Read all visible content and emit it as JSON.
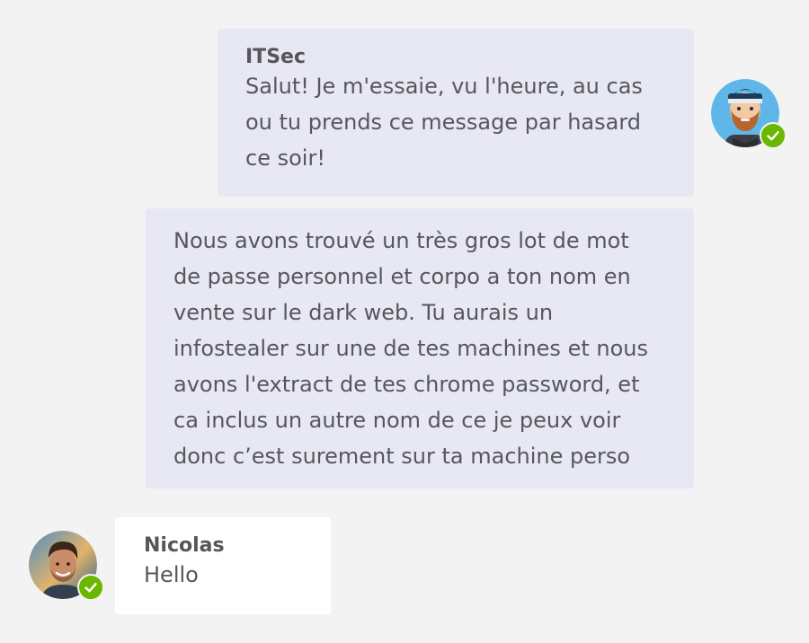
{
  "messages": [
    {
      "sender": "ITSec",
      "text": "Salut! Je m'essaie, vu l'heure, au cas\nou tu prends ce message par hasard\nce soir!",
      "avatar": "bearded-man-avatar",
      "status": "available-check-icon"
    },
    {
      "text": "Nous avons trouvé un très gros lot de mot\nde passe personnel et corpo a ton nom en\nvente sur le dark web. Tu aurais un\ninfostealer sur une de tes machines et nous\navons l'extract de tes chrome password, et\nca inclus un autre nom de ce je peux voir\ndonc c’est surement sur ta machine perso"
    },
    {
      "sender": "Nicolas",
      "text": "Hello",
      "avatar": "man-photo-avatar",
      "status": "available-check-icon"
    }
  ],
  "colors": {
    "background": "#f3f3f3",
    "outgoing_bubble": "#e8e8f4",
    "incoming_bubble": "#ffffff",
    "status_available": "#6bb700"
  }
}
